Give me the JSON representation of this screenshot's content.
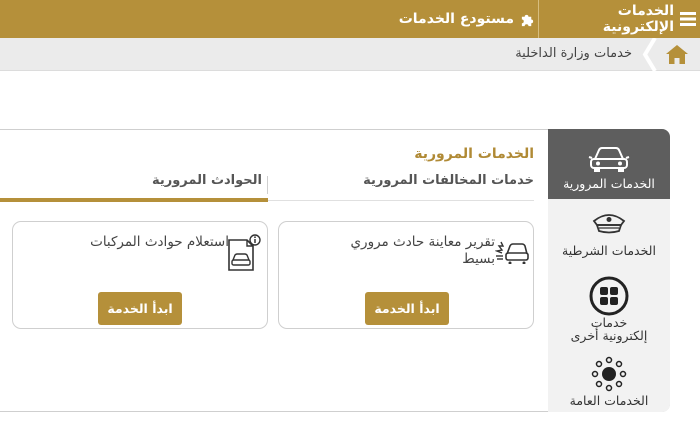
{
  "topbar": {
    "menu_label": "الخدمات الإلكترونية",
    "repository_label": "مستودع الخدمات"
  },
  "breadcrumb": {
    "current": "خدمات وزارة الداخلية"
  },
  "sidebar": {
    "items": [
      {
        "label": "الخدمات المرورية",
        "icon": "car-icon",
        "active": true
      },
      {
        "label": "الخدمات الشرطية",
        "icon": "police-cap-icon",
        "active": false
      },
      {
        "label": "خدمات إلكترونية أخرى",
        "icon": "apps-grid-icon",
        "active": false
      },
      {
        "label": "الخدمات العامة",
        "icon": "network-icon",
        "active": false
      }
    ]
  },
  "main": {
    "section_title": "الخدمات المرورية",
    "tabs": [
      {
        "label": "خدمات المخالفات المرورية",
        "active": false
      },
      {
        "label": "الحوادث المرورية",
        "active": true
      }
    ],
    "cards": [
      {
        "title": "تقرير معاينة حادث مروري بسيط",
        "icon": "car-crash-icon",
        "button": "ابدأ الخدمة"
      },
      {
        "title": "استعلام حوادث المركبات",
        "icon": "car-document-info-icon",
        "button": "ابدأ الخدمة"
      }
    ]
  },
  "colors": {
    "gold": "#b5903a",
    "gold_text": "#b08a35",
    "sidebar_active": "#5e5e5e",
    "breadcrumb_bg": "#ebebeb"
  }
}
